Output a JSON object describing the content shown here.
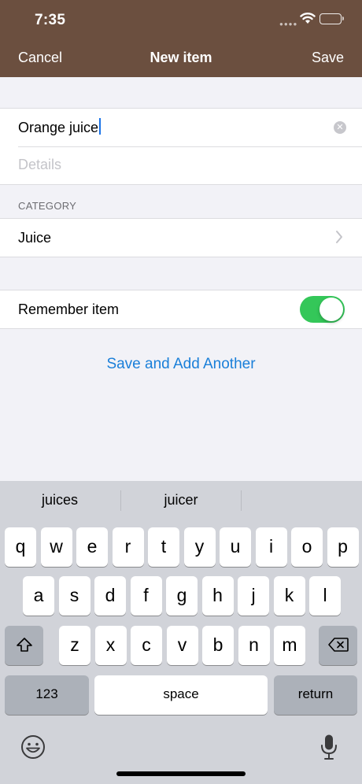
{
  "status_bar": {
    "time": "7:35"
  },
  "nav": {
    "cancel_label": "Cancel",
    "title": "New item",
    "save_label": "Save"
  },
  "form": {
    "name_value": "Orange juice",
    "details_placeholder": "Details",
    "category_header": "CATEGORY",
    "category_value": "Juice",
    "remember_label": "Remember item",
    "remember_enabled": true
  },
  "actions": {
    "save_and_add_label": "Save and Add Another"
  },
  "keyboard": {
    "suggestions": [
      "juices",
      "juicer"
    ],
    "row1": [
      "q",
      "w",
      "e",
      "r",
      "t",
      "y",
      "u",
      "i",
      "o",
      "p"
    ],
    "row2": [
      "a",
      "s",
      "d",
      "f",
      "g",
      "h",
      "j",
      "k",
      "l"
    ],
    "row3": [
      "z",
      "x",
      "c",
      "v",
      "b",
      "n",
      "m"
    ],
    "numbers_label": "123",
    "space_label": "space",
    "return_label": "return"
  },
  "colors": {
    "nav_bar": "#6b4f3f",
    "toggle_on": "#34c759",
    "link": "#1a7fd9",
    "caret": "#1a73e8",
    "keyboard_bg": "#d1d3d9"
  }
}
